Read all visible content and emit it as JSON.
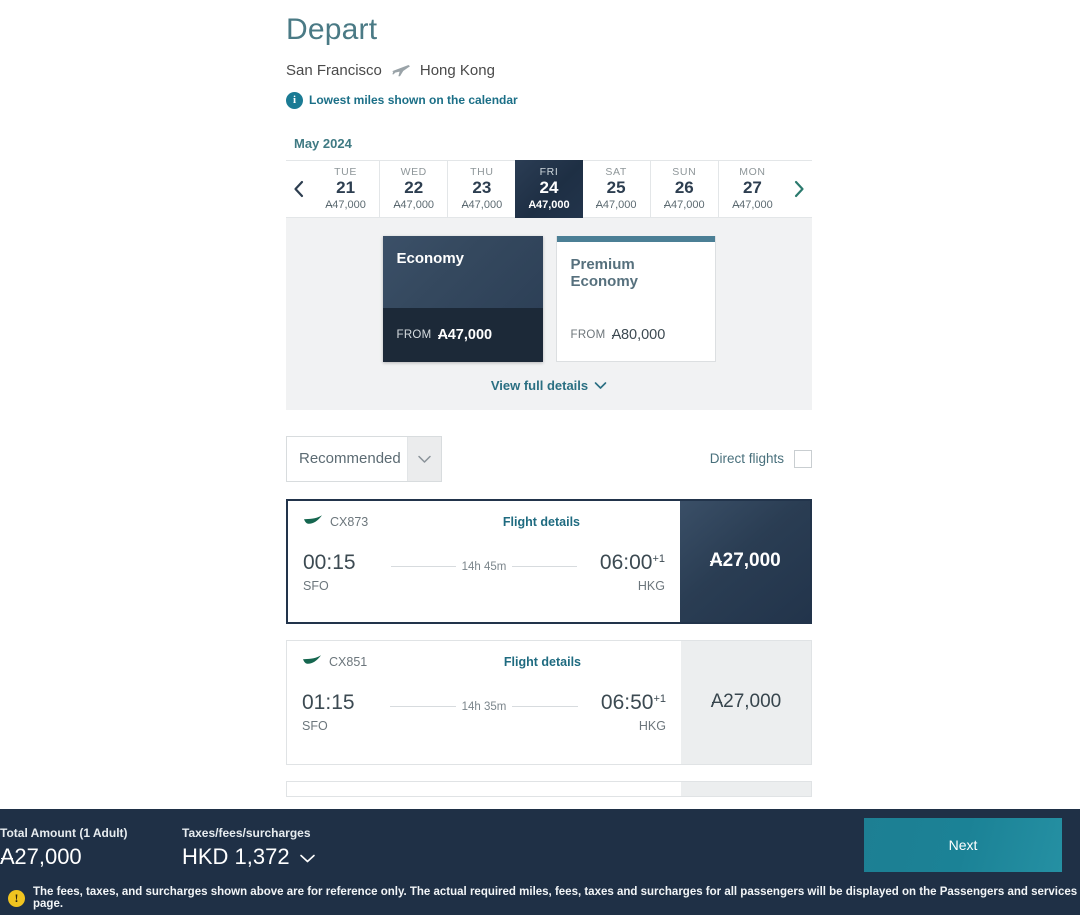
{
  "header": {
    "title": "Depart",
    "origin": "San Francisco",
    "destination": "Hong Kong",
    "plane_icon": "airplane-icon",
    "notice_icon": "info-icon",
    "notice_text": "Lowest miles shown on the calendar"
  },
  "calendar": {
    "month": "May 2024",
    "prev_icon": "chevron-left-icon",
    "next_icon": "chevron-right-icon",
    "days": [
      {
        "dow": "TUE",
        "num": "21",
        "miles": "47,000",
        "selected": false
      },
      {
        "dow": "WED",
        "num": "22",
        "miles": "47,000",
        "selected": false
      },
      {
        "dow": "THU",
        "num": "23",
        "miles": "47,000",
        "selected": false
      },
      {
        "dow": "FRI",
        "num": "24",
        "miles": "47,000",
        "selected": true
      },
      {
        "dow": "SAT",
        "num": "25",
        "miles": "47,000",
        "selected": false
      },
      {
        "dow": "SUN",
        "num": "26",
        "miles": "47,000",
        "selected": false
      },
      {
        "dow": "MON",
        "num": "27",
        "miles": "47,000",
        "selected": false
      }
    ]
  },
  "cabins": {
    "economy": {
      "title": "Economy",
      "from_label": "FROM",
      "from_value": "47,000",
      "selected": true
    },
    "premium": {
      "title": "Premium Economy",
      "from_label": "FROM",
      "from_value": "80,000",
      "selected": false
    },
    "view_details_label": "View full details",
    "view_details_icon": "chevron-down-icon"
  },
  "filters": {
    "sort_value": "Recommended",
    "sort_caret_icon": "chevron-down-icon",
    "direct_label": "Direct flights",
    "direct_checked": false
  },
  "flights": [
    {
      "airline_icon": "cathay-brushwing-icon",
      "flight_number": "CX873",
      "details_label": "Flight details",
      "depart_time": "00:15",
      "depart_airport": "SFO",
      "duration": "14h 45m",
      "arrive_time": "06:00",
      "arrive_day_offset": "+1",
      "arrive_airport": "HKG",
      "price": "27,000",
      "selected": true
    },
    {
      "airline_icon": "cathay-brushwing-icon",
      "flight_number": "CX851",
      "details_label": "Flight details",
      "depart_time": "01:15",
      "depart_airport": "SFO",
      "duration": "14h 35m",
      "arrive_time": "06:50",
      "arrive_day_offset": "+1",
      "arrive_airport": "HKG",
      "price": "27,000",
      "selected": false
    }
  ],
  "bottom_bar": {
    "total_label": "Total Amount (1 Adult)",
    "total_value": "27,000",
    "taxes_label": "Taxes/fees/surcharges",
    "taxes_value": "HKD 1,372",
    "taxes_caret_icon": "chevron-down-icon",
    "next_label": "Next",
    "warning_icon": "warning-icon",
    "footer_text": "The fees, taxes, and surcharges shown above are for reference only. The actual required miles, fees, taxes and surcharges for all passengers will be displayed on the Passengers and services page."
  },
  "colors": {
    "brand_teal": "#1b7b94",
    "navy": "#1f3046",
    "title_teal": "#4a7a85",
    "warning_yellow": "#f0c420",
    "panel_gray": "#f1f2f3",
    "cathay_green": "#116b54"
  }
}
